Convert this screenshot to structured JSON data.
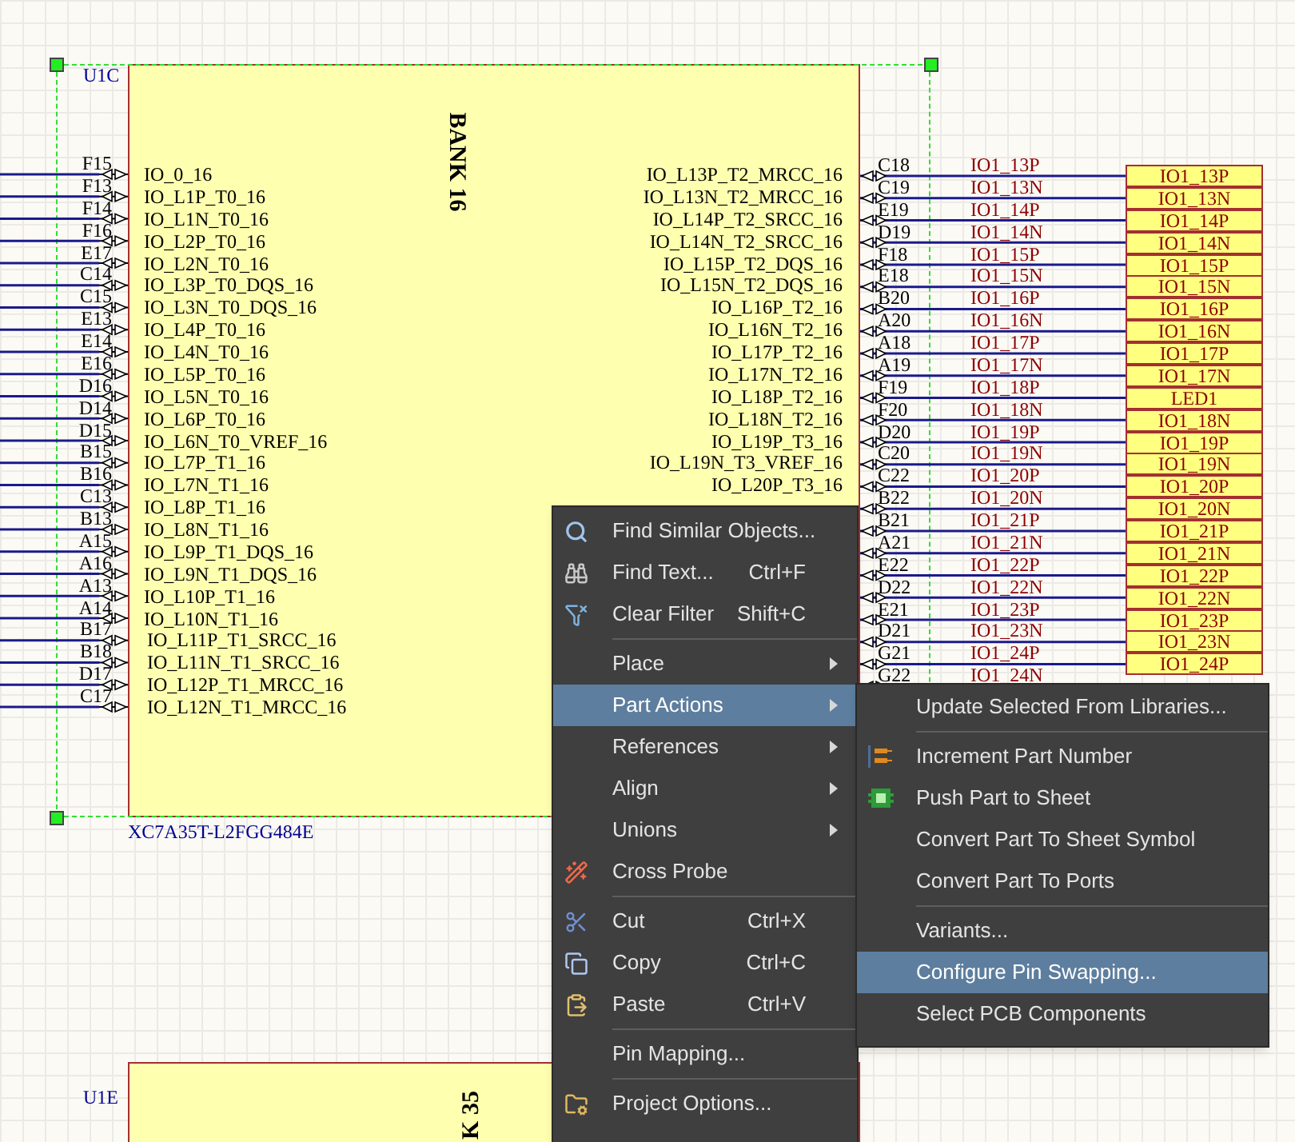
{
  "part": {
    "designator": "U1C",
    "bank_title": "BANK 16",
    "part_number": "XC7A35T-L2FGG484E",
    "left_pins": [
      {
        "number": "F15",
        "name": "IO_0_16"
      },
      {
        "number": "F13",
        "name": "IO_L1P_T0_16"
      },
      {
        "number": "F14",
        "name": "IO_L1N_T0_16"
      },
      {
        "number": "F16",
        "name": "IO_L2P_T0_16"
      },
      {
        "number": "E17",
        "name": "IO_L2N_T0_16"
      },
      {
        "number": "C14",
        "name": "IO_L3P_T0_DQS_16"
      },
      {
        "number": "C15",
        "name": "IO_L3N_T0_DQS_16"
      },
      {
        "number": "E13",
        "name": "IO_L4P_T0_16"
      },
      {
        "number": "E14",
        "name": "IO_L4N_T0_16"
      },
      {
        "number": "E16",
        "name": "IO_L5P_T0_16"
      },
      {
        "number": "D16",
        "name": "IO_L5N_T0_16"
      },
      {
        "number": "D14",
        "name": "IO_L6P_T0_16"
      },
      {
        "number": "D15",
        "name": "IO_L6N_T0_VREF_16"
      },
      {
        "number": "B15",
        "name": "IO_L7P_T1_16"
      },
      {
        "number": "B16",
        "name": "IO_L7N_T1_16"
      },
      {
        "number": "C13",
        "name": "IO_L8P_T1_16"
      },
      {
        "number": "B13",
        "name": "IO_L8N_T1_16"
      },
      {
        "number": "A15",
        "name": "IO_L9P_T1_DQS_16"
      },
      {
        "number": "A16",
        "name": "IO_L9N_T1_DQS_16"
      },
      {
        "number": "A13",
        "name": "IO_L10P_T1_16"
      },
      {
        "number": "A14",
        "name": "IO_L10N_T1_16"
      },
      {
        "number": "B17",
        "name": "IO_L11P_T1_SRCC_16"
      },
      {
        "number": "B18",
        "name": "IO_L11N_T1_SRCC_16"
      },
      {
        "number": "D17",
        "name": "IO_L12P_T1_MRCC_16"
      },
      {
        "number": "C17",
        "name": "IO_L12N_T1_MRCC_16"
      }
    ],
    "right_pins": [
      {
        "number": "C18",
        "name": "IO_L13P_T2_MRCC_16"
      },
      {
        "number": "C19",
        "name": "IO_L13N_T2_MRCC_16"
      },
      {
        "number": "E19",
        "name": "IO_L14P_T2_SRCC_16"
      },
      {
        "number": "D19",
        "name": "IO_L14N_T2_SRCC_16"
      },
      {
        "number": "F18",
        "name": "IO_L15P_T2_DQS_16"
      },
      {
        "number": "E18",
        "name": "IO_L15N_T2_DQS_16"
      },
      {
        "number": "B20",
        "name": "IO_L16P_T2_16"
      },
      {
        "number": "A20",
        "name": "IO_L16N_T2_16"
      },
      {
        "number": "A18",
        "name": "IO_L17P_T2_16"
      },
      {
        "number": "A19",
        "name": "IO_L17N_T2_16"
      },
      {
        "number": "F19",
        "name": "IO_L18P_T2_16"
      },
      {
        "number": "F20",
        "name": "IO_L18N_T2_16"
      },
      {
        "number": "D20",
        "name": "IO_L19P_T3_16"
      },
      {
        "number": "C20",
        "name": "IO_L19N_T3_VREF_16"
      },
      {
        "number": "C22",
        "name": "IO_L20P_T3_16"
      },
      {
        "number": "B22"
      },
      {
        "number": "B21"
      },
      {
        "number": "A21"
      },
      {
        "number": "E22"
      },
      {
        "number": "D22"
      },
      {
        "number": "E21"
      },
      {
        "number": "D21"
      },
      {
        "number": "G21"
      },
      {
        "number": "G22"
      }
    ]
  },
  "net_labels": [
    "IO1_13P",
    "IO1_13N",
    "IO1_14P",
    "IO1_14N",
    "IO1_15P",
    "IO1_15N",
    "IO1_16P",
    "IO1_16N",
    "IO1_17P",
    "IO1_17N",
    "IO1_18P",
    "IO1_18N",
    "IO1_19P",
    "IO1_19N",
    "IO1_20P",
    "IO1_20N",
    "IO1_21P",
    "IO1_21N",
    "IO1_22P",
    "IO1_22N",
    "IO1_23P",
    "IO1_23N",
    "IO1_24P",
    "IO1_24N"
  ],
  "ports": [
    "IO1_13P",
    "IO1_13N",
    "IO1_14P",
    "IO1_14N",
    "IO1_15P",
    "IO1_15N",
    "IO1_16P",
    "IO1_16N",
    "IO1_17P",
    "IO1_17N",
    "LED1",
    "IO1_18N",
    "IO1_19P",
    "IO1_19N",
    "IO1_20P",
    "IO1_20N",
    "IO1_21P",
    "IO1_21N",
    "IO1_22P",
    "IO1_22N",
    "IO1_23P",
    "IO1_23N",
    "IO1_24P"
  ],
  "second_part": {
    "designator": "U1E",
    "bank_title": "K 35"
  },
  "context_menu": {
    "items": [
      {
        "kind": "item",
        "label": "Find Similar Objects...",
        "has_submenu": false,
        "selected": false
      },
      {
        "kind": "item",
        "label": "Find Text...",
        "shortcut": "Ctrl+F",
        "has_submenu": false,
        "selected": false
      },
      {
        "kind": "item",
        "label": "Clear Filter",
        "shortcut": "Shift+C",
        "has_submenu": false,
        "selected": false
      },
      {
        "kind": "separator"
      },
      {
        "kind": "item",
        "label": "Place",
        "has_submenu": true,
        "selected": false
      },
      {
        "kind": "item",
        "label": "Part Actions",
        "has_submenu": true,
        "selected": true
      },
      {
        "kind": "item",
        "label": "References",
        "has_submenu": true,
        "selected": false
      },
      {
        "kind": "item",
        "label": "Align",
        "has_submenu": true,
        "selected": false
      },
      {
        "kind": "item",
        "label": "Unions",
        "has_submenu": true,
        "selected": false
      },
      {
        "kind": "item",
        "label": "Cross Probe",
        "has_submenu": false,
        "selected": false
      },
      {
        "kind": "separator"
      },
      {
        "kind": "item",
        "label": "Cut",
        "shortcut": "Ctrl+X",
        "has_submenu": false,
        "selected": false
      },
      {
        "kind": "item",
        "label": "Copy",
        "shortcut": "Ctrl+C",
        "has_submenu": false,
        "selected": false
      },
      {
        "kind": "item",
        "label": "Paste",
        "shortcut": "Ctrl+V",
        "has_submenu": false,
        "selected": false
      },
      {
        "kind": "separator"
      },
      {
        "kind": "item",
        "label": "Pin Mapping...",
        "has_submenu": false,
        "selected": false
      },
      {
        "kind": "separator"
      },
      {
        "kind": "item",
        "label": "Project Options...",
        "has_submenu": false,
        "selected": false
      }
    ]
  },
  "submenu": {
    "items": [
      {
        "kind": "item",
        "label": "Update Selected From Libraries...",
        "selected": false
      },
      {
        "kind": "separator"
      },
      {
        "kind": "item",
        "label": "Increment Part Number",
        "selected": false
      },
      {
        "kind": "item",
        "label": "Push Part to Sheet",
        "selected": false
      },
      {
        "kind": "item",
        "label": "Convert Part To Sheet Symbol",
        "selected": false
      },
      {
        "kind": "item",
        "label": "Convert Part To Ports",
        "selected": false
      },
      {
        "kind": "separator"
      },
      {
        "kind": "item",
        "label": "Variants...",
        "selected": false
      },
      {
        "kind": "item",
        "label": "Configure Pin Swapping...",
        "selected": true
      },
      {
        "kind": "item",
        "label": "Select PCB Components",
        "selected": false
      }
    ]
  }
}
